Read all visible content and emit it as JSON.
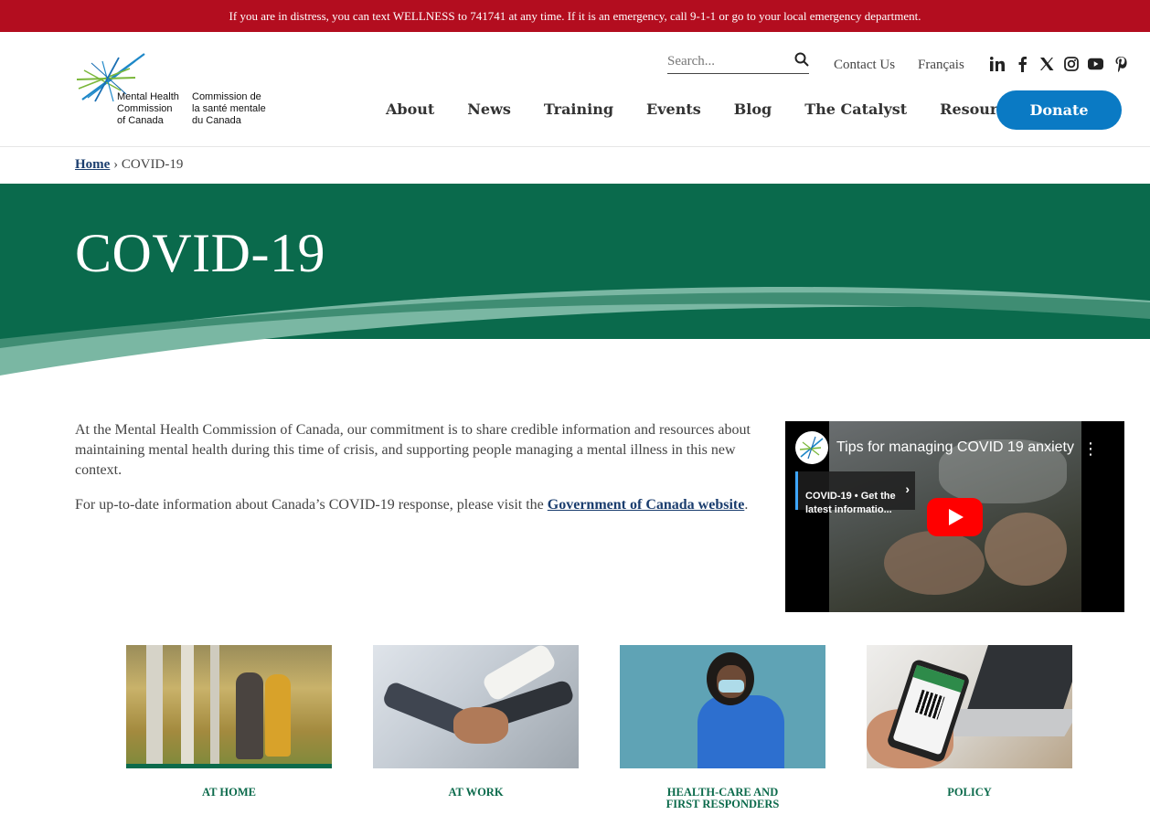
{
  "alert": {
    "text": "If you are in distress, you can text WELLNESS to 741741 at any time. If it is an emergency, call 9-1-1 or go to your local emergency department."
  },
  "logo": {
    "en": "Mental Health\nCommission\nof Canada",
    "fr": "Commission de\nla santé mentale\ndu Canada"
  },
  "search": {
    "placeholder": "Search..."
  },
  "utility": {
    "contact": "Contact Us",
    "language": "Français"
  },
  "social": [
    "linkedin-icon",
    "facebook-icon",
    "x-icon",
    "instagram-icon",
    "youtube-icon",
    "pinterest-icon"
  ],
  "nav": {
    "items": [
      "About",
      "News",
      "Training",
      "Events",
      "Blog",
      "The Catalyst",
      "Resources"
    ],
    "donate": "Donate"
  },
  "breadcrumb": {
    "home": "Home",
    "separator": "›",
    "current": "COVID-19"
  },
  "hero": {
    "title": "COVID-19"
  },
  "intro": {
    "p1": "At the Mental Health Commission of Canada, our commitment is to share credible information and resources about maintaining mental health during this time of crisis, and supporting people managing a mental illness in this new context.",
    "p2_prefix": "For up-to-date information about Canada’s COVID-19 response, please visit the ",
    "p2_link": "Government of Canada website",
    "p2_suffix": "."
  },
  "video": {
    "title": "Tips for managing COVID 19 anxiety",
    "card_text": "COVID-19 • Get the\nlatest informatio...",
    "more": "⋮",
    "chevron": "›"
  },
  "cards": [
    {
      "label": "AT HOME"
    },
    {
      "label": "AT WORK"
    },
    {
      "label": "HEALTH-CARE AND\nFIRST RESPONDERS"
    },
    {
      "label": "POLICY"
    }
  ],
  "colors": {
    "alert_bg": "#b30d1f",
    "hero_green": "#0a6a4c",
    "donate_blue": "#0a7ac4",
    "label_green": "#0b6a4b",
    "link_blue": "#1a3d6e"
  }
}
